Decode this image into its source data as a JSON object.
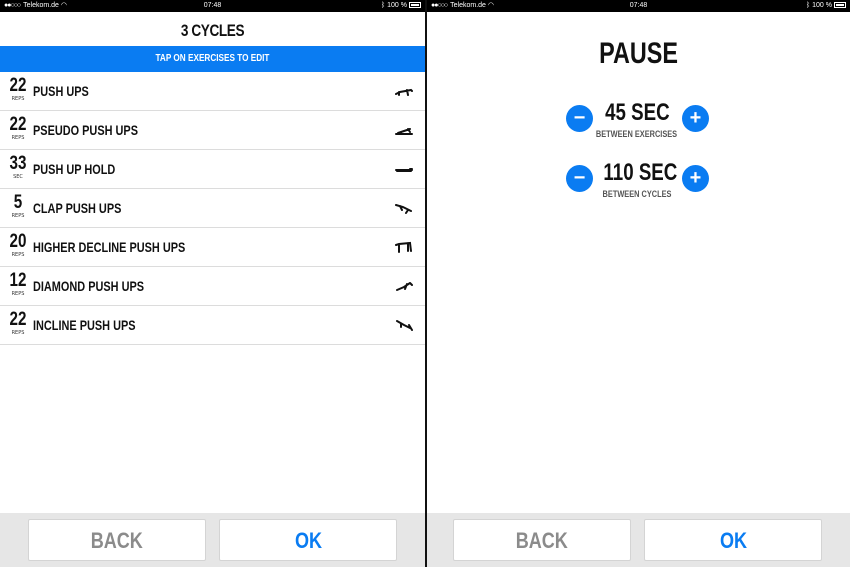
{
  "status_bar": {
    "carrier": "Telekom.de",
    "time": "07:48",
    "battery": "100 %"
  },
  "left": {
    "title": "3 CYCLES",
    "banner": "TAP ON EXERCISES TO EDIT",
    "exercises": [
      {
        "count": "22",
        "unit": "REPS",
        "name": "PUSH UPS",
        "icon": "push-up-icon"
      },
      {
        "count": "22",
        "unit": "REPS",
        "name": "PSEUDO PUSH UPS",
        "icon": "pseudo-push-up-icon"
      },
      {
        "count": "33",
        "unit": "SEC",
        "name": "PUSH UP HOLD",
        "icon": "plank-hold-icon"
      },
      {
        "count": "5",
        "unit": "REPS",
        "name": "CLAP PUSH UPS",
        "icon": "clap-push-up-icon"
      },
      {
        "count": "20",
        "unit": "REPS",
        "name": "HIGHER DECLINE PUSH UPS",
        "icon": "decline-push-up-icon"
      },
      {
        "count": "12",
        "unit": "REPS",
        "name": "DIAMOND PUSH UPS",
        "icon": "diamond-push-up-icon"
      },
      {
        "count": "22",
        "unit": "REPS",
        "name": "INCLINE PUSH UPS",
        "icon": "incline-push-up-icon"
      }
    ],
    "back_label": "BACK",
    "ok_label": "OK"
  },
  "right": {
    "title": "PAUSE",
    "exercise_pause": {
      "value": "45 SEC",
      "label": "BETWEEN EXERCISES"
    },
    "cycle_pause": {
      "value": "110 SEC",
      "label": "BETWEEN CYCLES"
    },
    "minus_symbol": "−",
    "plus_symbol": "+",
    "back_label": "BACK",
    "ok_label": "OK"
  },
  "colors": {
    "accent": "#0a7cf2",
    "back_text": "#8b8b8b",
    "footer_bg": "#e6e6e6"
  }
}
